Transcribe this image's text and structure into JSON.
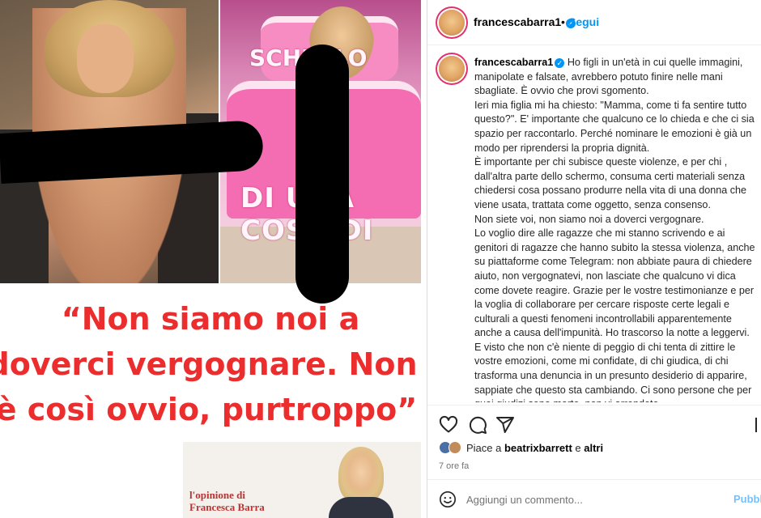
{
  "post": {
    "headline_line1": "“Non siamo noi a",
    "headline_line2": "doverci vergognare. Non",
    "headline_line3": "è così ovvio, purtroppo”",
    "cake_text": "DI UNA COSA DI",
    "cake_text2": "SCHERLO",
    "opinion_line1": "l'opinione di",
    "opinion_line2": "Francesca Barra"
  },
  "header": {
    "username": "francescabarra1",
    "separator": "•",
    "follow_label": "Segui"
  },
  "caption": {
    "username": "francescabarra1",
    "text": " Ho figli in un'età in cui quelle immagini, manipolate e falsate, avrebbero potuto finire nelle mani sbagliate. È ovvio che provi sgomento.\nIeri mia figlia mi ha chiesto: \"Mamma, come ti fa sentire tutto questo?\". E' importante che qualcuno ce lo chieda e che ci sia spazio per raccontarlo. Perché nominare le emozioni è già un modo per riprendersi la propria dignità.\nÈ importante per chi subisce queste violenze, e per chi , dall'altra parte dello schermo, consuma certi materiali senza chiedersi cosa possano produrre nella vita di una donna che viene usata, trattata come oggetto, senza consenso.\nNon siete voi, non siamo noi a doverci vergognare.\nLo voglio dire alle ragazze che mi stanno scrivendo e ai genitori di ragazze che hanno subito la stessa violenza, anche su piattaforme come Telegram: non abbiate paura di chiedere aiuto, non vergognatevi, non lasciate che qualcuno vi dica come dovete reagire. Grazie per le vostre testimonianze e per la voglia di collaborare per cercare risposte certe legali e culturali a questi fenomeni incontrollabili apparentemente anche a causa dell'impunità. Ho trascorso la notte a leggervi.\nE visto che non c'è niente di peggio di chi tenta di zittire le vostre emozioni, come mi confidate, di chi giudica, di chi trasforma una denuncia in un presunto desiderio di apparire, sappiate che questo sta cambiando. Ci sono persone che per quei giudizi sono morte, non vi arrendete.\nSono anni che sensibilizziamo sul pericolo della vittimizzazione secondaria e non può valere solo quando tocca noi, per poi"
  },
  "likes": {
    "prefix": "Piace a ",
    "user": "beatrixbarrett",
    "middle": " e ",
    "others": "altri"
  },
  "time": "7 ore fa",
  "comment": {
    "placeholder": "Aggiungi un commento...",
    "publish_label": "Pubblica"
  },
  "colors": {
    "accent": "#0095f6",
    "headline": "#ec2d2d",
    "publish_disabled": "#78bff8"
  },
  "icons": [
    "heart-icon",
    "comment-icon",
    "share-icon",
    "save-icon",
    "emoji-icon",
    "verified-badge-icon"
  ]
}
